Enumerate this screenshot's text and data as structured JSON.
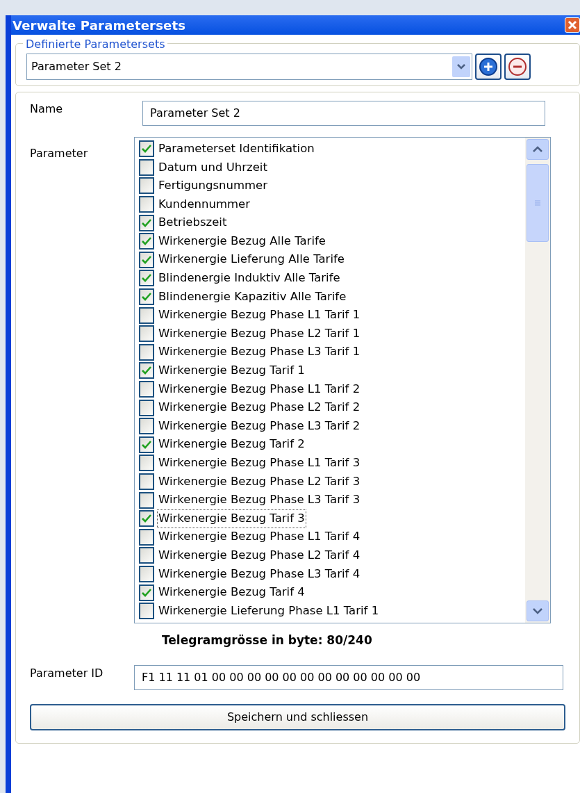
{
  "window": {
    "title": "Verwalte Parametersets"
  },
  "group": {
    "legend": "Definierte Parametersets",
    "selected_set": "Parameter Set 2"
  },
  "name_field": {
    "label": "Name",
    "value": "Parameter Set 2"
  },
  "parameters": {
    "label": "Parameter",
    "items": [
      {
        "label": "Parameterset Identifikation",
        "checked": true,
        "focused": false
      },
      {
        "label": "Datum und Uhrzeit",
        "checked": false,
        "focused": false
      },
      {
        "label": "Fertigungsnummer",
        "checked": false,
        "focused": false
      },
      {
        "label": "Kundennummer",
        "checked": false,
        "focused": false
      },
      {
        "label": "Betriebszeit",
        "checked": true,
        "focused": false
      },
      {
        "label": "Wirkenergie Bezug Alle Tarife",
        "checked": true,
        "focused": false
      },
      {
        "label": "Wirkenergie Lieferung Alle Tarife",
        "checked": true,
        "focused": false
      },
      {
        "label": "Blindenergie Induktiv Alle Tarife",
        "checked": true,
        "focused": false
      },
      {
        "label": "Blindenergie Kapazitiv Alle Tarife",
        "checked": true,
        "focused": false
      },
      {
        "label": "Wirkenergie Bezug Phase L1 Tarif 1",
        "checked": false,
        "focused": false
      },
      {
        "label": "Wirkenergie Bezug Phase L2 Tarif 1",
        "checked": false,
        "focused": false
      },
      {
        "label": "Wirkenergie Bezug Phase L3 Tarif 1",
        "checked": false,
        "focused": false
      },
      {
        "label": "Wirkenergie Bezug Tarif 1",
        "checked": true,
        "focused": false
      },
      {
        "label": "Wirkenergie Bezug Phase L1 Tarif 2",
        "checked": false,
        "focused": false
      },
      {
        "label": "Wirkenergie Bezug Phase L2 Tarif 2",
        "checked": false,
        "focused": false
      },
      {
        "label": "Wirkenergie Bezug Phase L3 Tarif 2",
        "checked": false,
        "focused": false
      },
      {
        "label": "Wirkenergie Bezug Tarif 2",
        "checked": true,
        "focused": false
      },
      {
        "label": "Wirkenergie Bezug Phase L1 Tarif 3",
        "checked": false,
        "focused": false
      },
      {
        "label": "Wirkenergie Bezug Phase L2 Tarif 3",
        "checked": false,
        "focused": false
      },
      {
        "label": "Wirkenergie Bezug Phase L3 Tarif 3",
        "checked": false,
        "focused": false
      },
      {
        "label": "Wirkenergie Bezug Tarif 3",
        "checked": true,
        "focused": true
      },
      {
        "label": "Wirkenergie Bezug Phase L1 Tarif 4",
        "checked": false,
        "focused": false
      },
      {
        "label": "Wirkenergie Bezug Phase L2 Tarif 4",
        "checked": false,
        "focused": false
      },
      {
        "label": "Wirkenergie Bezug Phase L3 Tarif 4",
        "checked": false,
        "focused": false
      },
      {
        "label": "Wirkenergie Bezug Tarif 4",
        "checked": true,
        "focused": false
      },
      {
        "label": "Wirkenergie Lieferung Phase L1 Tarif 1",
        "checked": false,
        "focused": false
      }
    ]
  },
  "telegram_size": "Telegramgrösse in byte: 80/240",
  "parameter_id": {
    "label": "Parameter ID",
    "value": "F1 11 11 01 00 00 00 00 00 00 00 00 00 00 00 00"
  },
  "buttons": [
    "Speichern und schliessen"
  ]
}
